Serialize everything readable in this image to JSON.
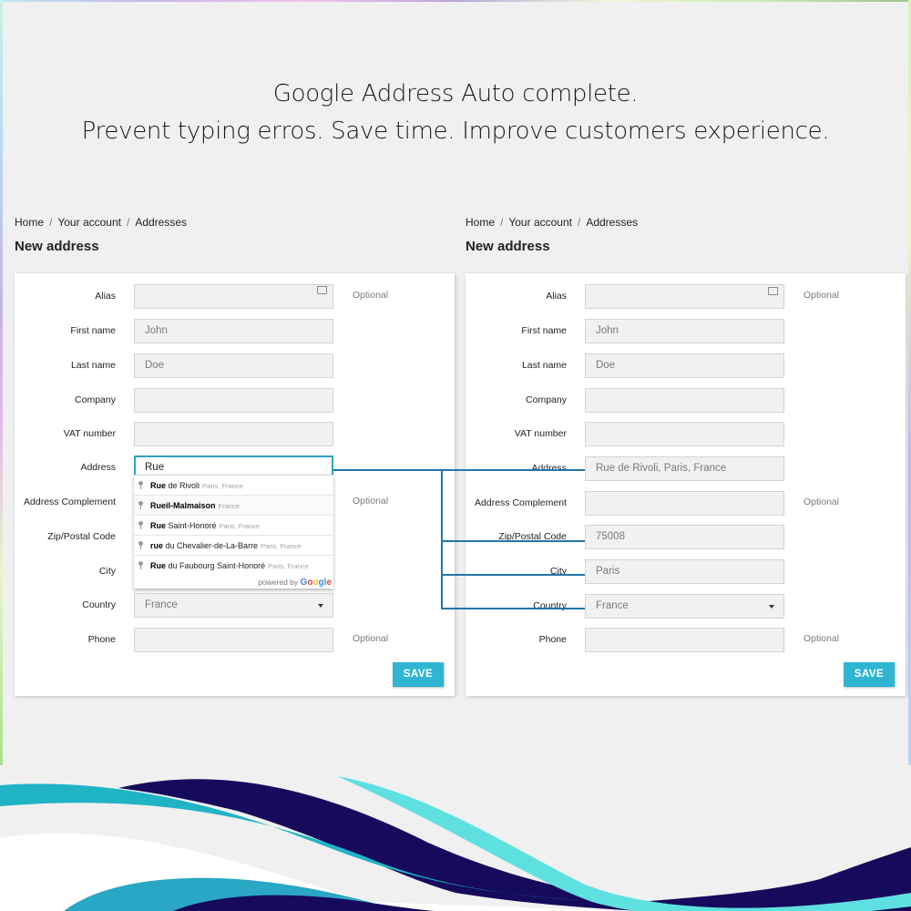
{
  "headline": {
    "line1": "Google Address Auto complete.",
    "line2": "Prevent typing erros. Save time. Improve customers experience."
  },
  "colors": {
    "accent": "#2fb5d2",
    "focus_border": "#2fa3c3",
    "connector": "#2374ad",
    "wave_navy": "#160a5c",
    "wave_teal": "#20b3c6",
    "wave_aqua": "#5fe0e0"
  },
  "left_panel": {
    "breadcrumb": [
      "Home",
      "Your account",
      "Addresses"
    ],
    "title": "New address",
    "fields": [
      {
        "label": "Alias",
        "value": "",
        "optional": "Optional",
        "icon": "address-card-icon"
      },
      {
        "label": "First name",
        "value": "John"
      },
      {
        "label": "Last name",
        "value": "Doe"
      },
      {
        "label": "Company",
        "value": ""
      },
      {
        "label": "VAT number",
        "value": ""
      },
      {
        "label": "Address",
        "value": "Rue"
      },
      {
        "label": "Address Complement",
        "value": "",
        "optional": "Optional"
      },
      {
        "label": "Zip/Postal Code",
        "value": ""
      },
      {
        "label": "City",
        "value": ""
      },
      {
        "label": "Country",
        "value": "France"
      },
      {
        "label": "Phone",
        "value": "",
        "optional": "Optional"
      }
    ],
    "save_label": "SAVE",
    "autocomplete": {
      "suggestions": [
        {
          "match": "Rue",
          "rest": " de Rivoli",
          "secondary": "Paris, France"
        },
        {
          "match": "Rue",
          "rest": "il-Malmaison",
          "secondary": "France"
        },
        {
          "match": "Rue",
          "rest": " Saint-Honoré",
          "secondary": "Paris, France"
        },
        {
          "match": "rue",
          "rest": " du Chevalier-de-La-Barre",
          "secondary": "Paris, France"
        },
        {
          "match": "Rue",
          "rest": " du Faubourg Saint-Honoré",
          "secondary": "Paris, France"
        }
      ],
      "powered_by": "powered by",
      "google": "Google"
    }
  },
  "right_panel": {
    "breadcrumb": [
      "Home",
      "Your account",
      "Addresses"
    ],
    "title": "New address",
    "fields": [
      {
        "label": "Alias",
        "value": "",
        "optional": "Optional",
        "icon": "address-card-icon"
      },
      {
        "label": "First name",
        "value": "John"
      },
      {
        "label": "Last name",
        "value": "Doe"
      },
      {
        "label": "Company",
        "value": ""
      },
      {
        "label": "VAT number",
        "value": ""
      },
      {
        "label": "Address",
        "value": "Rue de Rivoli, Paris, France"
      },
      {
        "label": "Address Complement",
        "value": "",
        "optional": "Optional"
      },
      {
        "label": "Zip/Postal Code",
        "value": "75008"
      },
      {
        "label": "City",
        "value": "Paris"
      },
      {
        "label": "Country",
        "value": "France"
      },
      {
        "label": "Phone",
        "value": "",
        "optional": "Optional"
      }
    ],
    "save_label": "SAVE"
  }
}
